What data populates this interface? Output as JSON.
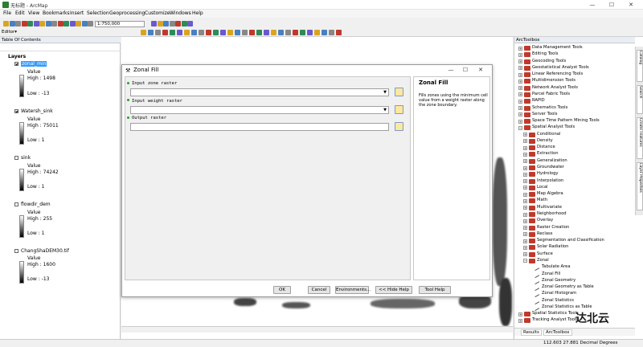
{
  "window": {
    "title": "无标题 - ArcMap"
  },
  "menu": [
    "File",
    "Edit",
    "View",
    "Bookmarks",
    "Insert",
    "Selection",
    "Geoprocessing",
    "Customize",
    "Windows",
    "Help"
  ],
  "toolbar": {
    "scale": "1:750,000",
    "editor": "Editor▾"
  },
  "toc": {
    "title": "Table Of Contents",
    "root": "Layers",
    "layers": [
      {
        "name": "zonal_min",
        "high": "High : 1498",
        "low": "Low : -13"
      },
      {
        "name": "Watersh_sink",
        "high": "High : 75011",
        "low": "Low : 1"
      },
      {
        "name": "sink",
        "high": "High : 74242",
        "low": "Low : 1"
      },
      {
        "name": "flowdir_dem",
        "high": "High : 255",
        "low": "Low : 1"
      },
      {
        "name": "ChangShaDEM30.tif",
        "high": "High : 1600",
        "low": "Low : -13"
      }
    ],
    "value_label": "Value"
  },
  "dialog": {
    "title": "Zonal Fill",
    "params": [
      "Input zone raster",
      "Input weight raster",
      "Output raster"
    ],
    "help_title": "Zonal Fill",
    "help_text": "Fills zones using the minimum cell value from a weight raster along the zone boundary.",
    "buttons": {
      "ok": "OK",
      "cancel": "Cancel",
      "env": "Environments...",
      "hide": "<< Hide Help",
      "toolhelp": "Tool Help"
    }
  },
  "arctoolbox": {
    "title": "ArcToolbox",
    "toolboxes": [
      "Data Management Tools",
      "Editing Tools",
      "Geocoding Tools",
      "Geostatistical Analyst Tools",
      "Linear Referencing Tools",
      "Multidimension Tools",
      "Network Analyst Tools",
      "Parcel Fabric Tools",
      "RAPID",
      "Schematics Tools",
      "Server Tools",
      "Space Time Pattern Mining Tools",
      "Spatial Analyst Tools"
    ],
    "spatial": [
      "Conditional",
      "Density",
      "Distance",
      "Extraction",
      "Generalization",
      "Groundwater",
      "Hydrology",
      "Interpolation",
      "Local",
      "Map Algebra",
      "Math",
      "Multivariate",
      "Neighborhood",
      "Overlay",
      "Raster Creation",
      "Reclass",
      "Segmentation and Classification",
      "Solar Radiation",
      "Surface",
      "Zonal"
    ],
    "zonal_tools": [
      "Tabulate Area",
      "Zonal Fill",
      "Zonal Geometry",
      "Zonal Geometry as Table",
      "Zonal Histogram",
      "Zonal Statistics",
      "Zonal Statistics as Table"
    ],
    "after": [
      "Spatial Statistics Tools",
      "Tracking Analyst Tools"
    ],
    "tabs": [
      "Results",
      "ArcToolbox"
    ]
  },
  "vertical_tabs": [
    "Catalog",
    "Search",
    "Create Features",
    "Layer Properties"
  ],
  "status": {
    "coords": "112.603  27.881 Decimal Degrees"
  },
  "watermark": "达北云"
}
